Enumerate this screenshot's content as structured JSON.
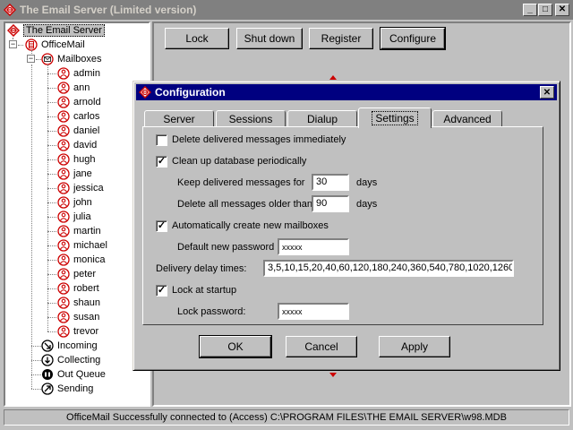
{
  "window": {
    "title": "The Email Server (Limited version)",
    "min": "_",
    "max": "□",
    "close": "✕"
  },
  "tree": {
    "root": "The Email Server",
    "officemail": "OfficeMail",
    "mailboxes": "Mailboxes",
    "users": [
      "admin",
      "ann",
      "arnold",
      "carlos",
      "daniel",
      "david",
      "hugh",
      "jane",
      "jessica",
      "john",
      "julia",
      "martin",
      "michael",
      "monica",
      "peter",
      "robert",
      "shaun",
      "susan",
      "trevor"
    ],
    "incoming": "Incoming",
    "collecting": "Collecting",
    "outqueue": "Out Queue",
    "sending": "Sending"
  },
  "toolbar": {
    "lock": "Lock",
    "shutdown": "Shut down",
    "register": "Register",
    "configure": "Configure"
  },
  "dialog": {
    "title": "Configuration",
    "tabs": [
      "Server",
      "Sessions",
      "Dialup",
      "Settings",
      "Advanced"
    ],
    "active_tab": "Settings",
    "delete_delivered": {
      "label": "Delete delivered messages immediately",
      "checked": false
    },
    "cleanup": {
      "label": "Clean up database periodically",
      "checked": true
    },
    "keep_label": "Keep delivered messages for",
    "keep_value": "30",
    "keep_unit": "days",
    "delete_older_label": "Delete all messages older than",
    "delete_older_value": "90",
    "delete_older_unit": "days",
    "auto_create": {
      "label": "Automatically create new mailboxes",
      "checked": true
    },
    "default_pw_label": "Default new password",
    "default_pw_value": "xxxxx",
    "delay_label": "Delivery delay times:",
    "delay_value": "3,5,10,15,20,40,60,120,180,240,360,540,780,1020,1260,",
    "lock_startup": {
      "label": "Lock at startup",
      "checked": true
    },
    "lock_pw_label": "Lock password:",
    "lock_pw_value": "xxxxx",
    "ok": "OK",
    "cancel": "Cancel",
    "apply": "Apply"
  },
  "status": "OfficeMail Successfully connected to (Access) C:\\PROGRAM FILES\\THE EMAIL SERVER\\w98.MDB",
  "colors": {
    "accent": "#cc0000",
    "titlebar_inactive": "#808080",
    "titlebar_active": "#000080"
  }
}
